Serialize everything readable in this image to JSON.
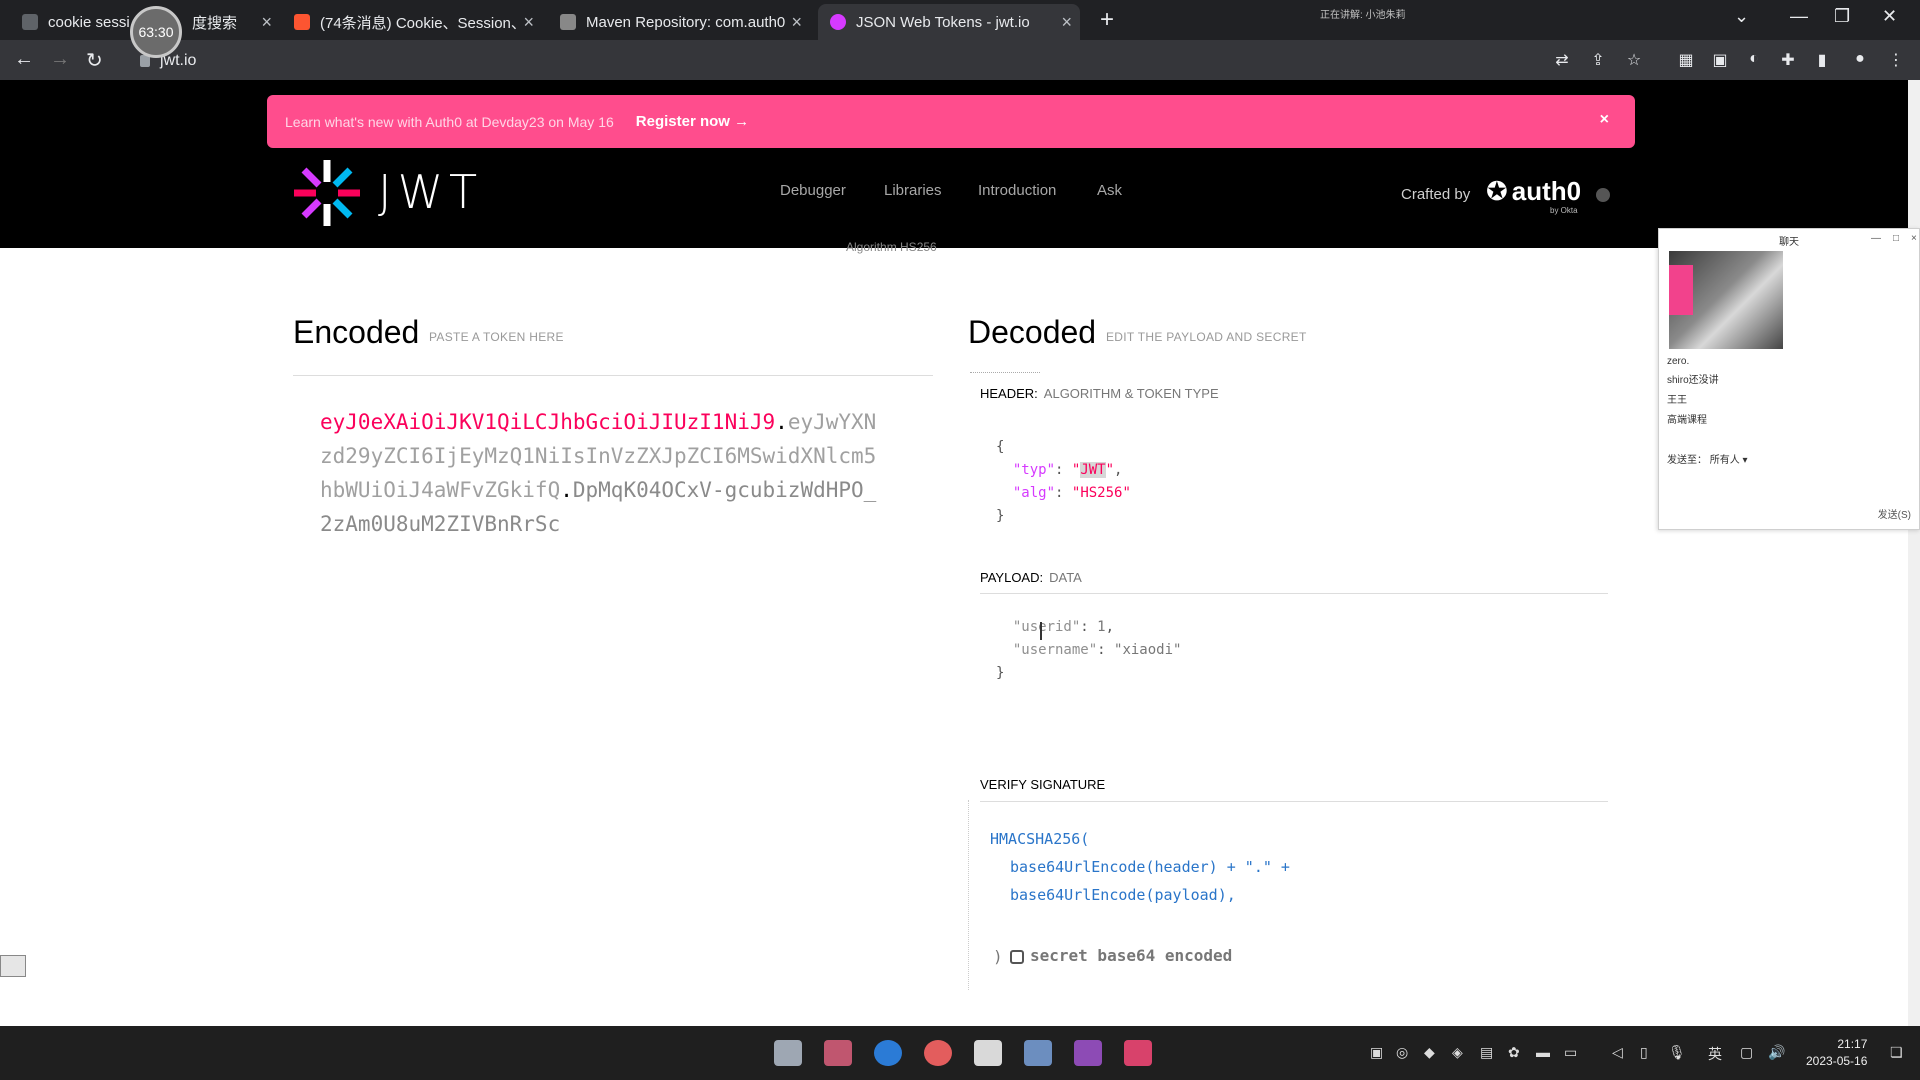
{
  "browser": {
    "tabs": [
      {
        "label": "cookie sessi",
        "fav_color": "#5f6368"
      },
      {
        "label": "度搜索",
        "fav_color": "#3867ff"
      },
      {
        "label": "(74条消息) Cookie、Session、",
        "fav_color": "#fc5531"
      },
      {
        "label": "Maven Repository: com.auth0",
        "fav_color": "#888888"
      },
      {
        "label": "JSON Web Tokens - jwt.io",
        "fav_color": "#d63aff"
      }
    ],
    "timer": "63:30",
    "url": "jwt.io",
    "notification": "正在讲解: 小池朱莉"
  },
  "banner": {
    "text": "Learn what's new with Auth0 at Devday23 on May 16",
    "cta": "Register now →",
    "close": "×"
  },
  "header": {
    "logo_text": "JWT",
    "nav": [
      "Debugger",
      "Libraries",
      "Introduction",
      "Ask"
    ],
    "crafted_by": "Crafted by",
    "auth0": "auth0",
    "by_okta": "by Okta"
  },
  "algorithm_peek": "Algorithm   HS256",
  "encoded": {
    "title": "Encoded",
    "subtitle": "PASTE A TOKEN HERE",
    "token_header": "eyJ0eXAiOiJKV1QiLCJhbGciOiJIUzI1NiJ9",
    "token_payload": "eyJwYXNzd29yZCI6IjEyMzQ1NiIsInVzZXJpZCI6MSwidXNlcm5hbWUiOiJ4aWFvZGkifQ",
    "token_signature": "DpMqK04OCxV-gcubizWdHPO_2zAm0U8uM2ZIVBnRrSc"
  },
  "decoded": {
    "title": "Decoded",
    "subtitle": "EDIT THE PAYLOAD AND SECRET",
    "header_label": "HEADER:",
    "header_sub": "ALGORITHM & TOKEN TYPE",
    "header_json": {
      "typ": "JWT",
      "alg": "HS256"
    },
    "payload_label": "PAYLOAD:",
    "payload_sub": "DATA",
    "payload_userid": "1",
    "payload_username": "xiaodi",
    "verify_label": "VERIFY SIGNATURE",
    "sig_fn": "HMACSHA256(",
    "sig_line1": "base64UrlEncode(header) + \".\" +",
    "sig_line2": "base64UrlEncode(payload),",
    "secret_label": "secret base64 encoded"
  },
  "chat": {
    "title": "聊天",
    "lines": [
      "zero.",
      "shiro还没讲",
      "王王",
      "高端课程"
    ],
    "recipient": "发送至：  所有人 ▾",
    "send": "发送(S)"
  },
  "taskbar": {
    "apps": [
      "#9ea7b3",
      "#c0566f",
      "#2b7bd6",
      "#e35d5d",
      "#d9d9d9",
      "#6c8ebf",
      "#8d4bb5",
      "#d8426b"
    ],
    "time": "21:17",
    "date": "2023-05-16",
    "ime": "英"
  }
}
